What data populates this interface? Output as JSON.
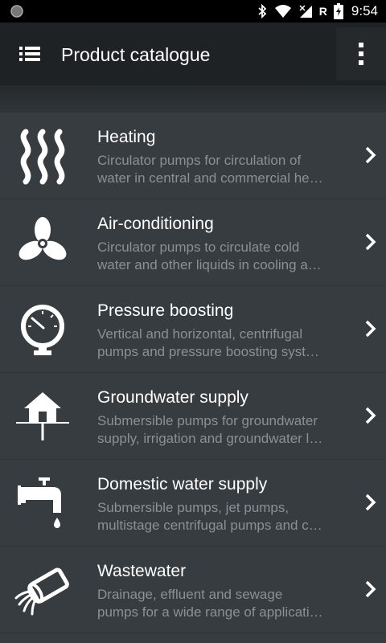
{
  "status_bar": {
    "time": "9:54",
    "network_badge": "R",
    "icons": [
      "circle-icon",
      "bluetooth-icon",
      "wifi-icon",
      "signal-icon",
      "battery-icon"
    ]
  },
  "app_bar": {
    "title": "Product catalogue",
    "icons": [
      "menu-list-icon",
      "overflow-menu-icon"
    ]
  },
  "colors": {
    "background": "#373c40",
    "app_bar": "#1f2224",
    "description_text": "#8b9094"
  },
  "items": [
    {
      "title": "Heating",
      "desc1": "Circulator pumps for circulation of",
      "desc2": "water in central and commercial he…",
      "icon": "heating-waves-icon"
    },
    {
      "title": "Air-conditioning",
      "desc1": "Circulator pumps to circulate cold",
      "desc2": "water and other liquids in cooling a…",
      "icon": "fan-icon"
    },
    {
      "title": "Pressure boosting",
      "desc1": "Vertical and horizontal, centrifugal",
      "desc2": "pumps and pressure boosting syst…",
      "icon": "pressure-gauge-icon"
    },
    {
      "title": "Groundwater supply",
      "desc1": "Submersible pumps for groundwater",
      "desc2": "supply, irrigation and groundwater l…",
      "icon": "house-well-icon"
    },
    {
      "title": "Domestic water supply",
      "desc1": "Submersible pumps, jet pumps,",
      "desc2": "multistage centrifugal pumps and c…",
      "icon": "water-tap-icon"
    },
    {
      "title": "Wastewater",
      "desc1": "Drainage, effluent and sewage",
      "desc2": "pumps for a wide range of applicati…",
      "icon": "wastewater-pipe-icon"
    }
  ]
}
